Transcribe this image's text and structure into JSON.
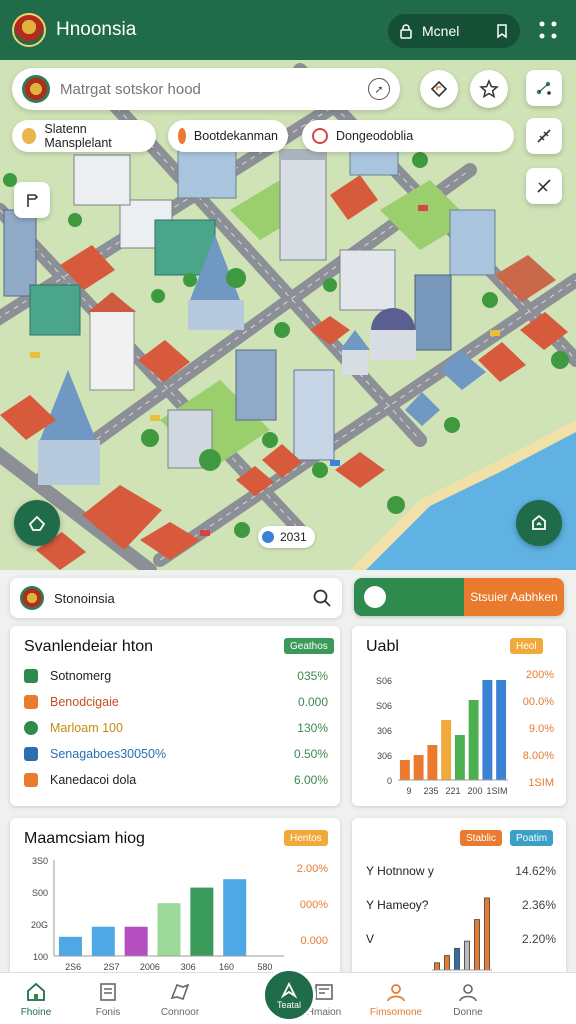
{
  "header": {
    "title": "Hnoonsia",
    "pill_label": "Mcnel"
  },
  "search": {
    "placeholder": "Matrgat sotskor hood"
  },
  "chips": [
    {
      "label": "Slatenn Mansplelant",
      "color": "#e8b64a"
    },
    {
      "label": "Bootdekanman",
      "color": "#e97a2e"
    },
    {
      "label": "Dongeodoblia",
      "color": "#d64545"
    }
  ],
  "map": {
    "year_tag": "2031"
  },
  "location": {
    "name": "Stonoinsia"
  },
  "split_button": {
    "label": "Stsuier Aabhken"
  },
  "stats_card": {
    "title": "Svanlendeiar hton",
    "badge": "Geathos",
    "rows": [
      {
        "label": "Sotnomerg",
        "value": "035%",
        "icon_color": "#2f8a4e",
        "label_color": "#222"
      },
      {
        "label": "Benodcigaie",
        "value": "0.000",
        "icon_color": "#e97a2e",
        "label_color": "#c4501f"
      },
      {
        "label": "Marloam 100",
        "value": "130%",
        "icon_color": "#2f8a4e",
        "label_color": "#c48a10"
      },
      {
        "label": "Senagaboes30050%",
        "value": "0.50%",
        "icon_color": "#2a6fb0",
        "label_color": "#2a6fb0"
      },
      {
        "label": "Kanedacoi dola",
        "value": "6.00%",
        "icon_color": "#e97a2e",
        "label_color": "#222"
      }
    ]
  },
  "chart_card": {
    "title": "Uabl",
    "badge": "Heol"
  },
  "chart_data": [
    {
      "type": "bar",
      "title": "Uabl",
      "y_tick_labels": [
        "S06",
        "S06",
        "306",
        "306",
        "0"
      ],
      "x_tick_labels": [
        "9",
        "235",
        "221",
        "200",
        "1SIM"
      ],
      "right_labels": [
        "200%",
        "00.0%",
        "9.0%",
        "8.00%",
        "1SIM"
      ],
      "categories": [
        "a",
        "b",
        "c",
        "d",
        "e",
        "f",
        "g",
        "h"
      ],
      "values": [
        20,
        25,
        35,
        60,
        45,
        80,
        100,
        100
      ],
      "colors": [
        "#e97a2e",
        "#e97a2e",
        "#e97a2e",
        "#f0a93a",
        "#4caf50",
        "#4caf50",
        "#3b82d6",
        "#3b82d6"
      ],
      "ylim": [
        0,
        100
      ]
    },
    {
      "type": "bar",
      "title": "Maamcsiam hiog",
      "y_tick_labels": [
        "3S0",
        "S00",
        "20G",
        "100"
      ],
      "x_tick_labels": [
        "2S6",
        "2S7",
        "2006",
        "306",
        "160",
        "580"
      ],
      "right_labels": [
        "2.00%",
        "000%",
        "0.000"
      ],
      "categories": [
        "a",
        "b",
        "c",
        "d",
        "e",
        "f",
        "g"
      ],
      "values": [
        80,
        122,
        122,
        220,
        285,
        320,
        0
      ],
      "colors": [
        "#4ea8e6",
        "#4ea8e6",
        "#b34fc0",
        "#9ad99a",
        "#3a9a5a",
        "#4ea8e6",
        "#ffffff"
      ],
      "ylim": [
        0,
        400
      ]
    },
    {
      "type": "bar",
      "title": "",
      "categories": [
        "a",
        "b",
        "c",
        "d",
        "e",
        "f"
      ],
      "values": [
        10,
        20,
        30,
        40,
        70,
        100
      ],
      "colors": [
        "#e97a2e",
        "#e97a2e",
        "#2a6fb0",
        "#bbbbbb",
        "#e97a2e",
        "#e97a2e"
      ],
      "ylim": [
        0,
        100
      ]
    }
  ],
  "bar_card": {
    "title": "Maamcsiam hiog",
    "badge": "Hentos"
  },
  "legend_card": {
    "badge_left": "Stablic",
    "badge_right": "Poatim",
    "rows": [
      {
        "label": "Y Hotnnow y",
        "pct": "14.62%"
      },
      {
        "label": "Y Hameoy?",
        "pct": "2.36%"
      },
      {
        "label": "V",
        "pct": "2.20%"
      }
    ]
  },
  "nav": {
    "items": [
      {
        "label": "Fhoine",
        "active": true
      },
      {
        "label": "Fonis"
      },
      {
        "label": "Connoor"
      },
      {
        "label": "Teatal"
      },
      {
        "label": "Hmaion"
      },
      {
        "label": "Fimsomone",
        "highlight": true
      },
      {
        "label": "Donne"
      }
    ]
  },
  "colors": {
    "primary": "#1f6b4a",
    "accent": "#e97a2e",
    "green": "#2f8a4e",
    "blue": "#3b82d6"
  }
}
